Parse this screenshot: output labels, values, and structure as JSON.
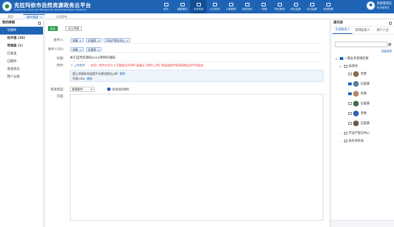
{
  "header": {
    "title": "克拉玛依市自然资源政务云平台",
    "subtitle": "Karamay Land and Resources Administration Platform",
    "nav": [
      "首页",
      "重要通知",
      "业务系统",
      "公文系统",
      "人事管理",
      "系统检索",
      "一张图",
      "项目管理",
      "综合监管",
      "执法监察",
      "系统配置"
    ],
    "active_nav_index": 2,
    "user": {
      "name": "系统管理员",
      "subtitle": "系统管理员"
    }
  },
  "tabs": [
    {
      "label": "首页",
      "closable": false
    },
    {
      "label": "邮件管理",
      "closable": true,
      "active": true
    },
    {
      "label": "公文发布",
      "closable": false
    }
  ],
  "sidebar": {
    "title": "我的邮箱",
    "items": [
      {
        "label": "写邮件",
        "active": true
      },
      {
        "label": "收件箱 (30)",
        "bold": true
      },
      {
        "label": "草稿箱 (1)",
        "bold": true
      },
      {
        "label": "已发送"
      },
      {
        "label": "已删除"
      },
      {
        "label": "发送状态"
      },
      {
        "label": "用户分组"
      }
    ]
  },
  "compose": {
    "send_label": "发送",
    "draft_label": "存为草稿",
    "recipient_label": "收件人：",
    "recipients": [
      "李勇",
      "石俊豪",
      "不动产登记中心"
    ],
    "cc_label": "收件人(外)：",
    "cc": [
      "李勇",
      "石俊豪"
    ],
    "subject_label": "标题：",
    "subject": "关于自然资源局xxxx项目的通知",
    "attach_label": "附件：",
    "upload_label": "上传附件",
    "upload_tip": "实例：附件文件大小不能超过500M    请通过【附件上传】按钮或附件框直接拖动文件到此处",
    "files": [
      {
        "name": "国土资源综合监管平台建设报告.pdf",
        "delete_label": "删除"
      },
      {
        "name": "列表.xlsx",
        "delete_label": "删除"
      }
    ],
    "send_type_label": "发送类型：",
    "send_type_value": "普通邮件",
    "notify_label": "发送短信通知",
    "content_label": "内容："
  },
  "contacts": {
    "title": "通讯录",
    "tabs": [
      "全部联系人",
      "常用联系人",
      "用户人员"
    ],
    "active_tab_index": 0,
    "filter_label": "高级搜索",
    "tree": [
      {
        "label": "一期业务受理结果",
        "level": 0,
        "checked": true,
        "expanded": true
      },
      {
        "label": "局领导",
        "level": 1,
        "checked": false,
        "expanded": true
      },
      {
        "label": "李勇",
        "level": 2,
        "checked": false,
        "face_color": "#8b6b4a"
      },
      {
        "label": "石俊豪",
        "level": 2,
        "checked": true,
        "face_color": "#5a7d9a"
      },
      {
        "label": "李勇",
        "level": 2,
        "checked": true,
        "face_color": "#b58763"
      },
      {
        "label": "石俊豪",
        "level": 2,
        "checked": false,
        "face_color": "#4a6a4e"
      },
      {
        "label": "李勇",
        "level": 2,
        "checked": false,
        "face_color": "#2f5fb3"
      },
      {
        "label": "石俊豪",
        "level": 2,
        "checked": false,
        "face_color": "#6c5a4a"
      },
      {
        "label": "不动产登记中心",
        "level": 1,
        "checked": false,
        "expanded": false
      },
      {
        "label": "协办领导局",
        "level": 1,
        "checked": false,
        "expanded": false
      }
    ]
  }
}
